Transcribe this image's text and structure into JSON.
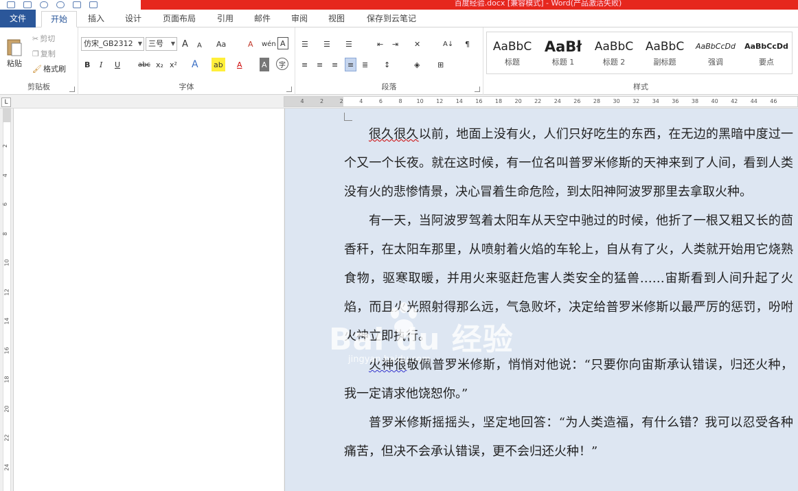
{
  "titlebar": {
    "document_title": "百度经验.docx [兼容模式] - Word(产品激活失败)"
  },
  "tabs": [
    {
      "label": "文件",
      "kind": "file"
    },
    {
      "label": "开始",
      "kind": "active"
    },
    {
      "label": "插入"
    },
    {
      "label": "设计"
    },
    {
      "label": "页面布局"
    },
    {
      "label": "引用"
    },
    {
      "label": "邮件"
    },
    {
      "label": "审阅"
    },
    {
      "label": "视图"
    },
    {
      "label": "保存到云笔记"
    }
  ],
  "clipboard": {
    "paste_label": "粘贴",
    "cut_label": "剪切",
    "copy_label": "复制",
    "format_painter_label": "格式刷",
    "group_label": "剪贴板"
  },
  "font": {
    "font_name": "仿宋_GB2312",
    "font_size": "三号",
    "grow_label": "A",
    "shrink_label": "A",
    "case_label": "Aa",
    "clear_label": "A",
    "phonetic_label": "wén",
    "border_label": "A",
    "bold_label": "B",
    "italic_label": "I",
    "underline_label": "U",
    "strike_label": "abc",
    "subscript_label": "x₂",
    "superscript_label": "x²",
    "effects_label": "A",
    "highlight_label": "ab",
    "font_color_label": "A",
    "shading_label": "A",
    "enclose_label": "字",
    "group_label": "字体"
  },
  "paragraph": {
    "group_label": "段落",
    "sort_label": "A↓",
    "marks_label": "¶"
  },
  "styles": {
    "group_label": "样式",
    "items": [
      {
        "sample": "AaBbC",
        "name": "标题"
      },
      {
        "sample": "AaBł",
        "name": "标题 1"
      },
      {
        "sample": "AaBbC",
        "name": "标题 2"
      },
      {
        "sample": "AaBbC",
        "name": "副标题"
      },
      {
        "sample": "AaBbCcDd",
        "name": "强调"
      },
      {
        "sample": "AaBbCcDd",
        "name": "要点"
      }
    ]
  },
  "ruler": {
    "corner_label": "L",
    "ticks": [
      "4",
      "2",
      "2",
      "4",
      "6",
      "8",
      "10",
      "12",
      "14",
      "16",
      "18",
      "20",
      "22",
      "24",
      "26",
      "28",
      "30",
      "32",
      "34",
      "36",
      "38",
      "40",
      "42",
      "44",
      "46"
    ],
    "vticks": [
      "2",
      "4",
      "6",
      "8",
      "10",
      "12",
      "14",
      "16",
      "18",
      "20",
      "22",
      "24"
    ]
  },
  "document": {
    "paragraphs": [
      {
        "lead_mark": "很久很久",
        "rest": "以前，地面上没有火，人们只好吃生的东西，在无边的黑暗中度过一个又一个长夜。就在这时候，有一位名叫普罗米修斯的天神来到了人间，看到人类没有火的悲惨情景，决心冒着生命危险，到太阳神阿波罗那里去拿取火种。"
      },
      {
        "lead_mark": "",
        "rest": "有一天，当阿波罗驾着太阳车从天空中驰过的时候，他折了一根又粗又长的茴香秆，在太阳车那里，从喷射着火焰的车轮上，自从有了火，人类就开始用它烧熟食物，驱寒取暖，并用火来驱赶危害人类安全的猛兽……宙斯看到人间升起了火焰，而且火光照射得那么远，气急败坏，决定给普罗米修斯以最严厉的惩罚，吩咐火神立即执行。"
      },
      {
        "lead_mark": "火神很",
        "rest": "敬佩普罗米修斯，悄悄对他说：“只要你向宙斯承认错误，归还火种，我一定请求他饶恕你。”"
      },
      {
        "lead_mark": "",
        "rest": "普罗米修斯摇摇头，坚定地回答：“为人类造福，有什么错？我可以忍受各种痛苦，但决不会承认错误，更不会归还火种！”"
      }
    ]
  },
  "watermark": {
    "brand": "Bai  du 经验",
    "url": "jingyan.baidu.com"
  },
  "colors": {
    "file_tab": "#2b579a",
    "title_red": "#e6271d",
    "doc_background": "#dde6f2"
  }
}
